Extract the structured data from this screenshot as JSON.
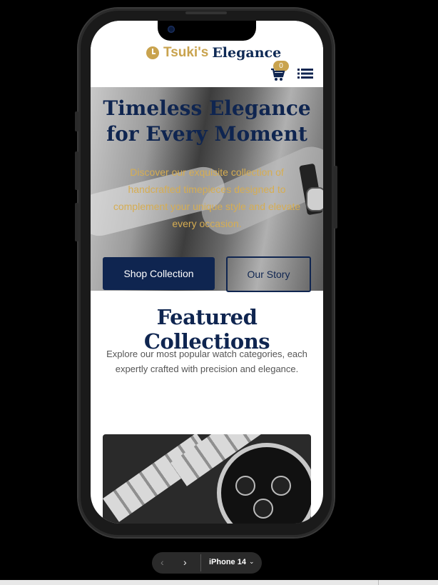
{
  "header": {
    "brand_part1": "Tsuki's",
    "brand_part2": "Elegance",
    "cart_count": "0",
    "icons": [
      "clock-icon",
      "cart-icon",
      "menu-list-icon"
    ]
  },
  "hero": {
    "title_line1": "Timeless Elegance",
    "title_line2": "for Every Moment",
    "subtitle": "Discover our exquisite collection of handcrafted timepieces designed to complement your unique style and elevate every occasion.",
    "primary_button": "Shop Collection",
    "secondary_button": "Our Story"
  },
  "featured": {
    "title": "Featured Collections",
    "subtitle": "Explore our most popular watch categories, each expertly crafted with precision and elegance."
  },
  "device_toolbar": {
    "device_name": "iPhone 14",
    "prev_symbol": "‹",
    "next_symbol": "›",
    "chevron": "⌄"
  },
  "colors": {
    "navy": "#0f2550",
    "gold": "#c9a34e",
    "background": "#000000"
  }
}
